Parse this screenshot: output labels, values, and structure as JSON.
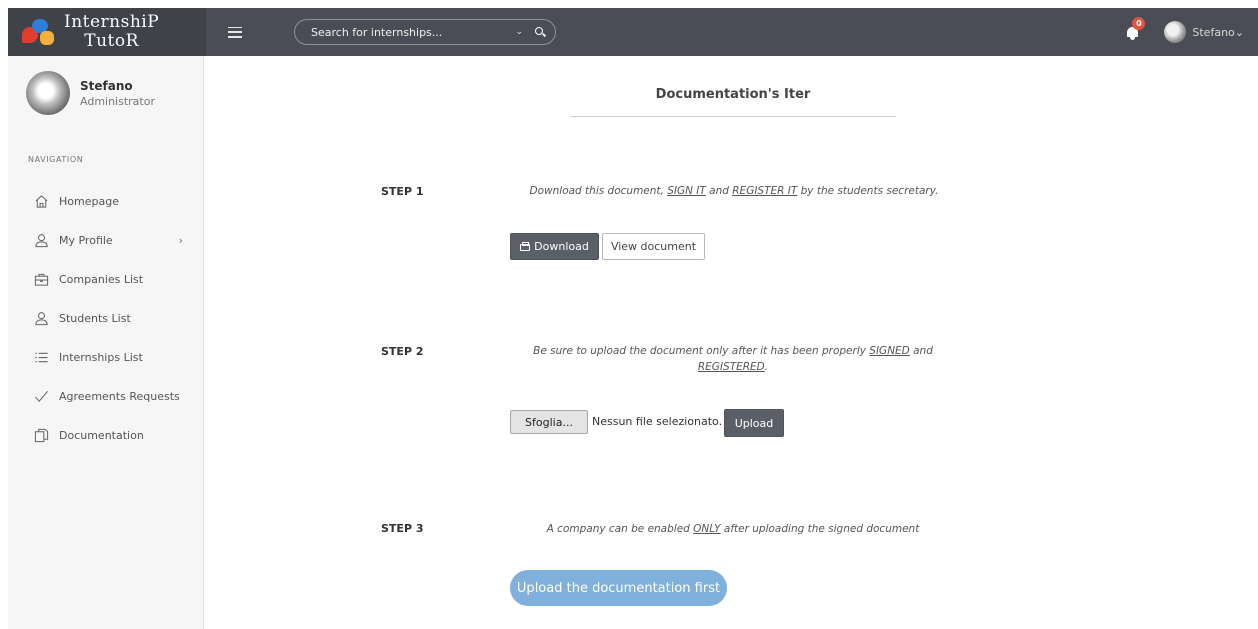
{
  "brand": {
    "line1": "InternshiP",
    "line2": "TutoR"
  },
  "search": {
    "placeholder": "Search for internships..."
  },
  "topbar": {
    "notification_count": "0",
    "user_name": "Stefano",
    "user_caret": "⌄"
  },
  "sidebar": {
    "user": {
      "name": "Stefano",
      "role": "Administrator"
    },
    "heading": "NAVIGATION",
    "items": [
      {
        "label": "Homepage",
        "icon": "home-icon"
      },
      {
        "label": "My Profile",
        "icon": "user-icon",
        "chevron": "›"
      },
      {
        "label": "Companies List",
        "icon": "briefcase-icon"
      },
      {
        "label": "Students List",
        "icon": "user-icon"
      },
      {
        "label": "Internships List",
        "icon": "list-icon"
      },
      {
        "label": "Agreements Requests",
        "icon": "check-icon"
      },
      {
        "label": "Documentation",
        "icon": "documents-icon"
      }
    ]
  },
  "main": {
    "title": "Documentation's Iter",
    "step1": {
      "label": "STEP 1",
      "desc_parts": [
        "Download this document, ",
        "SIGN IT",
        " and ",
        "REGISTER IT",
        " by the students secretary."
      ],
      "download_label": "Download",
      "view_label": "View document"
    },
    "step2": {
      "label": "STEP 2",
      "desc_parts": [
        "Be sure to upload the document only after it has been properly ",
        "SIGNED",
        " and",
        "REGISTERED",
        "."
      ],
      "browse_label": "Sfoglia...",
      "file_status": "Nessun file selezionato.",
      "upload_label": "Upload"
    },
    "step3": {
      "label": "STEP 3",
      "desc_parts": [
        "A company can be enabled ",
        "ONLY",
        " after uploading the signed document"
      ],
      "enable_label": "Upload the documentation first"
    }
  },
  "colors": {
    "topbar": "#4a4d55",
    "sidebar": "#f6f6f7",
    "badge": "#e2533f",
    "pill_button": "#7fb1dc",
    "dark_button": "#5b5f68"
  }
}
